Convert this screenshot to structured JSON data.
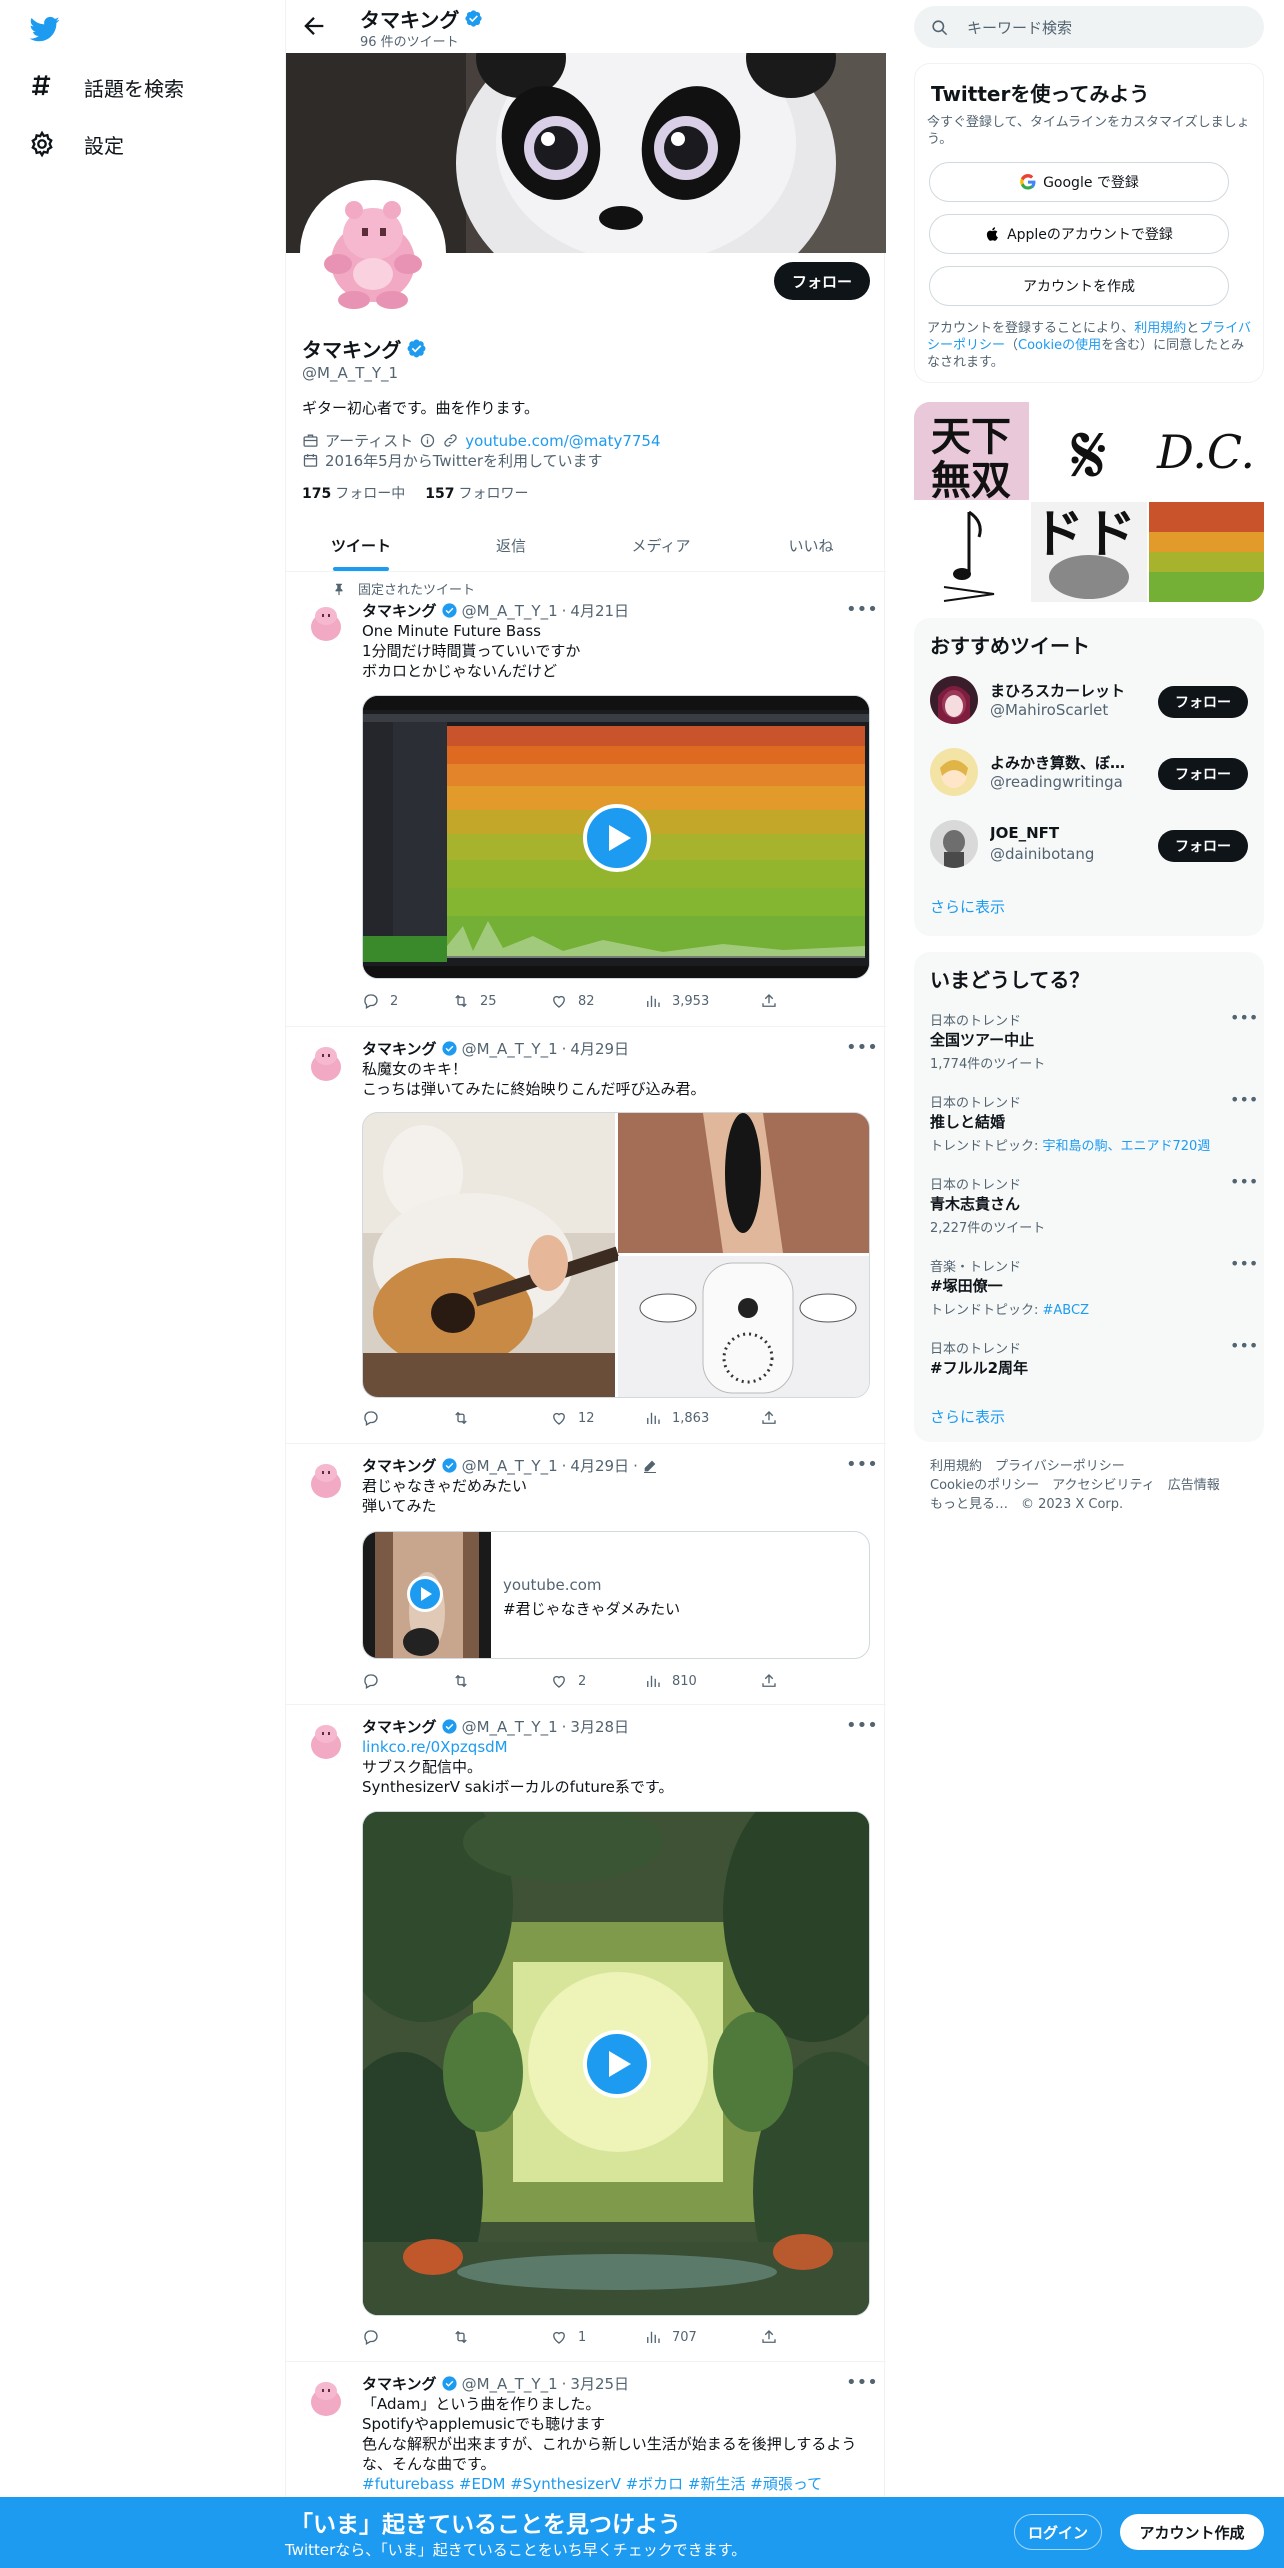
{
  "nav": {
    "explore_label": "話題を検索",
    "settings_label": "設定"
  },
  "profile": {
    "name": "タマキング",
    "tweet_count": "96 件のツイート",
    "handle": "@M_A_T_Y_1",
    "bio": "ギター初心者です。曲を作ります。",
    "category": "アーティスト",
    "link": "youtube.com/@maty7754",
    "joined": "2016年5月からTwitterを利用しています",
    "following_count": "175",
    "following_label": "フォロー中",
    "followers_count": "157",
    "followers_label": "フォロワー",
    "follow_button": "フォロー"
  },
  "tabs": [
    {
      "label": "ツイート"
    },
    {
      "label": "返信"
    },
    {
      "label": "メディア"
    },
    {
      "label": "いいね"
    }
  ],
  "tweets": [
    {
      "pinned_label": "固定されたツイート",
      "name": "タマキング",
      "handle": "@M_A_T_Y_1",
      "date": "4月21日",
      "lines": [
        "One Minute Future Bass",
        "1分間だけ時間貰っていいですか",
        "ボカロとかじゃないんだけど"
      ],
      "replies": "2",
      "retweets": "25",
      "likes": "82",
      "views": "3,953"
    },
    {
      "name": "タマキング",
      "handle": "@M_A_T_Y_1",
      "date": "4月29日",
      "lines": [
        "私魔女のキキ！",
        "こっちは弾いてみたに終始映りこんだ呼び込み君。"
      ],
      "replies": "",
      "retweets": "",
      "likes": "12",
      "views": "1,863"
    },
    {
      "name": "タマキング",
      "handle": "@M_A_T_Y_1",
      "date": "4月29日",
      "lines": [
        "君じゃなきゃだめみたい",
        "弾いてみた"
      ],
      "card_domain": "youtube.com",
      "card_title": "#君じゃなきゃダメみたい",
      "replies": "",
      "retweets": "",
      "likes": "2",
      "views": "810"
    },
    {
      "name": "タマキング",
      "handle": "@M_A_T_Y_1",
      "date": "3月28日",
      "link": "linkco.re/0XpzqsdM",
      "lines": [
        "サブスク配信中。",
        "SynthesizerV sakiボーカルのfuture系です。"
      ],
      "replies": "",
      "retweets": "",
      "likes": "1",
      "views": "707"
    },
    {
      "name": "タマキング",
      "handle": "@M_A_T_Y_1",
      "date": "3月25日",
      "lines": [
        "「Adam」という曲を作りました。",
        "Spotifyやapplemusicでも聴けます",
        "色んな解釈が出来ますが、これから新しい生活が始まるを後押しするよう",
        "な、そんな曲です。"
      ],
      "hashtags": "#futurebass #EDM #SynthesizerV #ボカロ #新生活 #頑張って"
    }
  ],
  "right": {
    "search_placeholder": "キーワード検索",
    "signup_title": "Twitterを使ってみよう",
    "signup_desc": "今すぐ登録して、タイムラインをカスタマイズしましょう。",
    "google_btn": "Google で登録",
    "apple_btn": "Appleのアカウントで登録",
    "create_btn": "アカウントを作成",
    "terms_1": "アカウントを登録することにより、",
    "terms_link1": "利用規約",
    "terms_2": "と",
    "terms_link2": "プライバシーポリシー",
    "terms_3": "（",
    "terms_link3": "Cookieの使用",
    "terms_4": "を含む）に同意したとみなされます。",
    "rec_title": "おすすめツイート",
    "recs": [
      {
        "name": "まひろスカーレット",
        "handle": "@MahiroScarlet",
        "button": "フォロー"
      },
      {
        "name": "よみかき算数、ぼく...",
        "handle": "@readingwritinga",
        "button": "フォロー"
      },
      {
        "name": "JOE_NFT",
        "handle": "@dainibotang",
        "button": "フォロー"
      }
    ],
    "show_more": "さらに表示",
    "trends_title": "いまどうしてる？",
    "trends": [
      {
        "cat": "日本のトレンド",
        "name": "全国ツアー中止",
        "sub": "1,774件のツイート"
      },
      {
        "cat": "日本のトレンド",
        "name": "推しと結婚",
        "sub_prefix": "トレンドトピック: ",
        "sub_link": "宇和島の駒、エニアド720週"
      },
      {
        "cat": "日本のトレンド",
        "name": "青木志貴さん",
        "sub": "2,227件のツイート"
      },
      {
        "cat": "音楽・トレンド",
        "name": "#塚田僚一",
        "sub_prefix": "トレンドトピック: ",
        "sub_link": "#ABCZ"
      },
      {
        "cat": "日本のトレンド",
        "name": "#フルル2周年"
      }
    ],
    "footer_line1": "利用規約　プライバシーポリシー",
    "footer_line2": "Cookieのポリシー　アクセシビリティ　広告情報",
    "footer_line3": "もっと見る…　© 2023 X Corp."
  },
  "bottom": {
    "title": "「いま」起きていることを見つけよう",
    "subtitle": "Twitterなら、「いま」起きていることをいち早くチェックできます。",
    "login": "ログイン",
    "signup": "アカウント作成"
  },
  "colors": {
    "accent": "#1d9bf0",
    "text": "#0f1419",
    "secondary": "#536471"
  }
}
